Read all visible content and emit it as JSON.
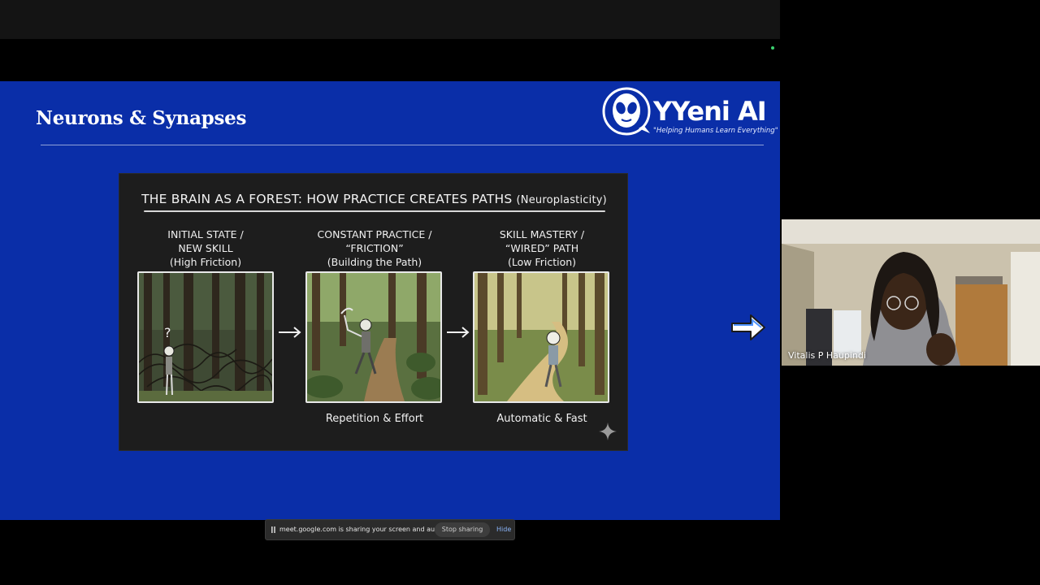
{
  "slide": {
    "title": "Neurons & Synapses",
    "logo": {
      "name": "YYeni AI",
      "tagline": "\"Helping Humans Learn Everything\""
    },
    "image": {
      "title": "THE BRAIN AS A FOREST: HOW PRACTICE CREATES PATHS",
      "title_paren": "(Neuroplasticity)",
      "stages": [
        {
          "line1": "INITIAL STATE /",
          "line2": "NEW SKILL",
          "line3": "(High Friction)",
          "caption": ""
        },
        {
          "line1": "CONSTANT PRACTICE /",
          "line2": "“FRICTION”",
          "line3": "(Building the Path)",
          "caption": "Repetition & Effort"
        },
        {
          "line1": "SKILL MASTERY /",
          "line2": "“WIRED” PATH",
          "line3": "(Low Friction)",
          "caption": "Automatic & Fast"
        }
      ]
    }
  },
  "video": {
    "participant_name": "Vitalis P Haupindi"
  },
  "share_bar": {
    "message": "meet.google.com is sharing your screen and audio.",
    "stop_label": "Stop sharing",
    "hide_label": "Hide"
  },
  "colors": {
    "slide_bg": "#0a2ea8",
    "card_bg": "#1d1d1d",
    "link": "#8ab4f8",
    "rec_dot": "#3bd16f"
  }
}
